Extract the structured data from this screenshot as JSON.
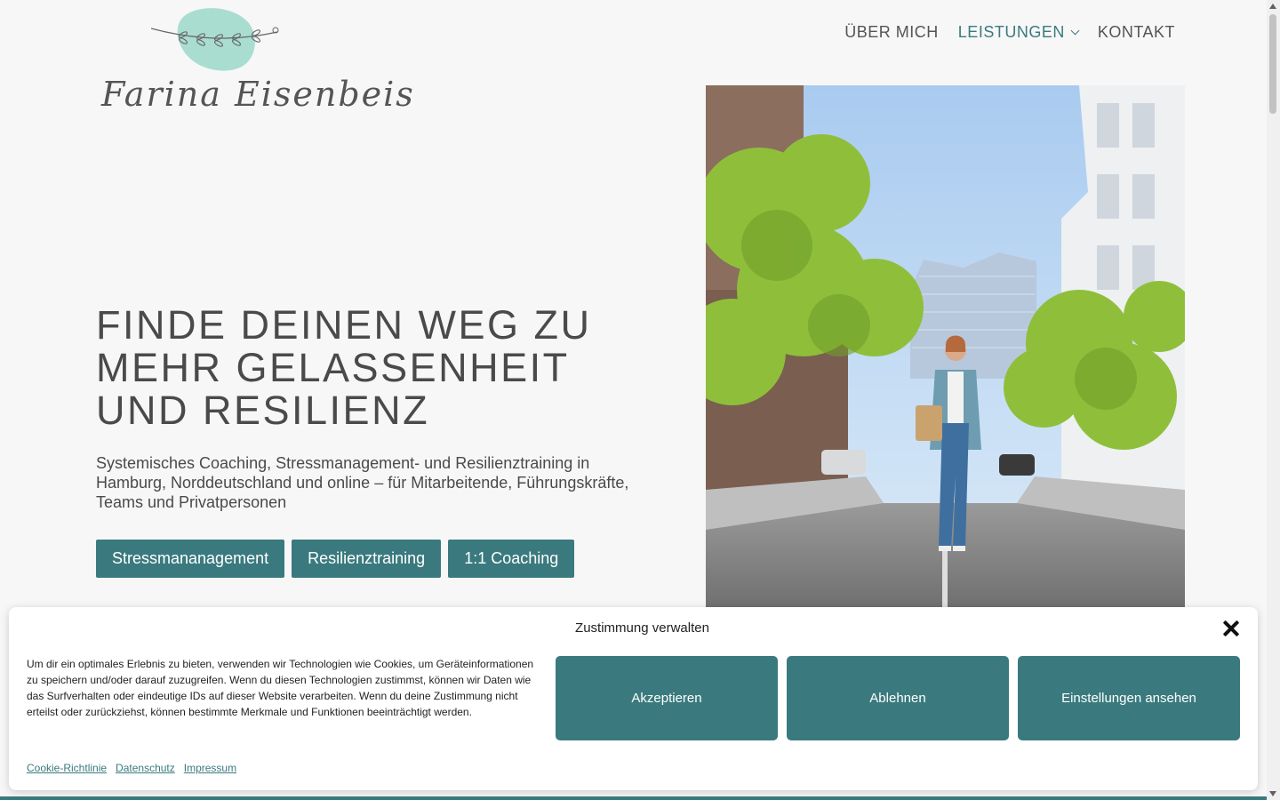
{
  "site": {
    "logo_text": "Farina Eisenbeis"
  },
  "nav": {
    "items": [
      {
        "label": "ÜBER MICH"
      },
      {
        "label": "LEISTUNGEN",
        "has_dropdown": true,
        "active": true
      },
      {
        "label": "KONTAKT"
      }
    ]
  },
  "hero": {
    "headline": "FINDE DEINEN WEG ZU MEHR GELASSENHEIT UND RESILIENZ",
    "subline": "Systemisches Coaching, Stressmanagement- und Resilienztraining in Hamburg, Norddeutschland und online – für Mitarbeitende, Führungskräfte, Teams und Privatpersonen",
    "buttons": [
      {
        "label": "Stressmananagement"
      },
      {
        "label": "Resilienztraining"
      },
      {
        "label": "1:1 Coaching"
      }
    ]
  },
  "consent": {
    "title": "Zustimmung verwalten",
    "text": "Um dir ein optimales Erlebnis zu bieten, verwenden wir Technologien wie Cookies, um Geräteinformationen zu speichern und/oder darauf zuzugreifen. Wenn du diesen Technologien zustimmst, können wir Daten wie das Surfverhalten oder eindeutige IDs auf dieser Website verarbeiten. Wenn du deine Zustimmung nicht erteilst oder zurückziehst, können bestimmte Merkmale und Funktionen beeinträchtigt werden.",
    "buttons": {
      "accept": "Akzeptieren",
      "deny": "Ablehnen",
      "settings": "Einstellungen ansehen"
    },
    "links": {
      "cookie_policy": "Cookie-Richtlinie",
      "privacy": "Datenschutz",
      "imprint": "Impressum"
    }
  },
  "colors": {
    "brand_teal": "#3a7a7e",
    "logo_blob_mint": "#a9ddd0",
    "background": "#f7f7f7"
  }
}
